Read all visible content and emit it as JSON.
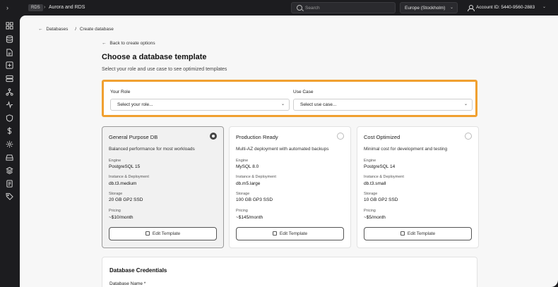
{
  "topbar": {
    "service_badge": "RDS",
    "separator": "›",
    "crumb": "Aurora and RDS",
    "search_placeholder": "Search",
    "region": "Europe (Stockholm)",
    "account": "Account ID: 5440-9560-2883"
  },
  "sidebar": {
    "icons": [
      "dashboard-icon",
      "database-icon",
      "document-icon",
      "plus-box-icon",
      "server-icon",
      "network-icon",
      "activity-icon",
      "shield-icon",
      "dollar-icon",
      "gear-icon",
      "storage-icon",
      "layers-icon",
      "report-icon",
      "tag-icon"
    ]
  },
  "breadcrumb": {
    "back_arrow": "←",
    "parent": "Databases",
    "separator": "/",
    "current": "Create database"
  },
  "back_link": "Back to create options",
  "page": {
    "title": "Choose a database template",
    "subtitle": "Select your role and use case to see optimized templates"
  },
  "filters": {
    "role_label": "Your Role",
    "role_value": "Select your role...",
    "usecase_label": "Use Case",
    "usecase_value": "Select use case...",
    "accent_color": "#f0a030"
  },
  "cards": [
    {
      "title": "General Purpose DB",
      "description": "Balanced performance for most workloads",
      "engine_label": "Engine",
      "engine": "PostgreSQL 15",
      "instance_label": "Instance & Deployment",
      "instance": "db.t3.medium",
      "storage_label": "Storage",
      "storage": "20 GB GP2 SSD",
      "pricing_label": "Pricing",
      "pricing": "~$10/month",
      "edit_label": "Edit Template",
      "selected": true
    },
    {
      "title": "Production Ready",
      "description": "Multi-AZ deployment with automated backups",
      "engine_label": "Engine",
      "engine": "MySQL 8.0",
      "instance_label": "Instance & Deployment",
      "instance": "db.m5.large",
      "storage_label": "Storage",
      "storage": "100 GB GP3 SSD",
      "pricing_label": "Pricing",
      "pricing": "~$145/month",
      "edit_label": "Edit Template",
      "selected": false
    },
    {
      "title": "Cost Optimized",
      "description": "Minimal cost for development and testing",
      "engine_label": "Engine",
      "engine": "PostgreSQL 14",
      "instance_label": "Instance & Deployment",
      "instance": "db.t3.small",
      "storage_label": "Storage",
      "storage": "10 GB GP2 SSD",
      "pricing_label": "Pricing",
      "pricing": "~$5/month",
      "edit_label": "Edit Template",
      "selected": false
    }
  ],
  "credentials": {
    "heading": "Database Credentials",
    "name_label": "Database Name *"
  }
}
